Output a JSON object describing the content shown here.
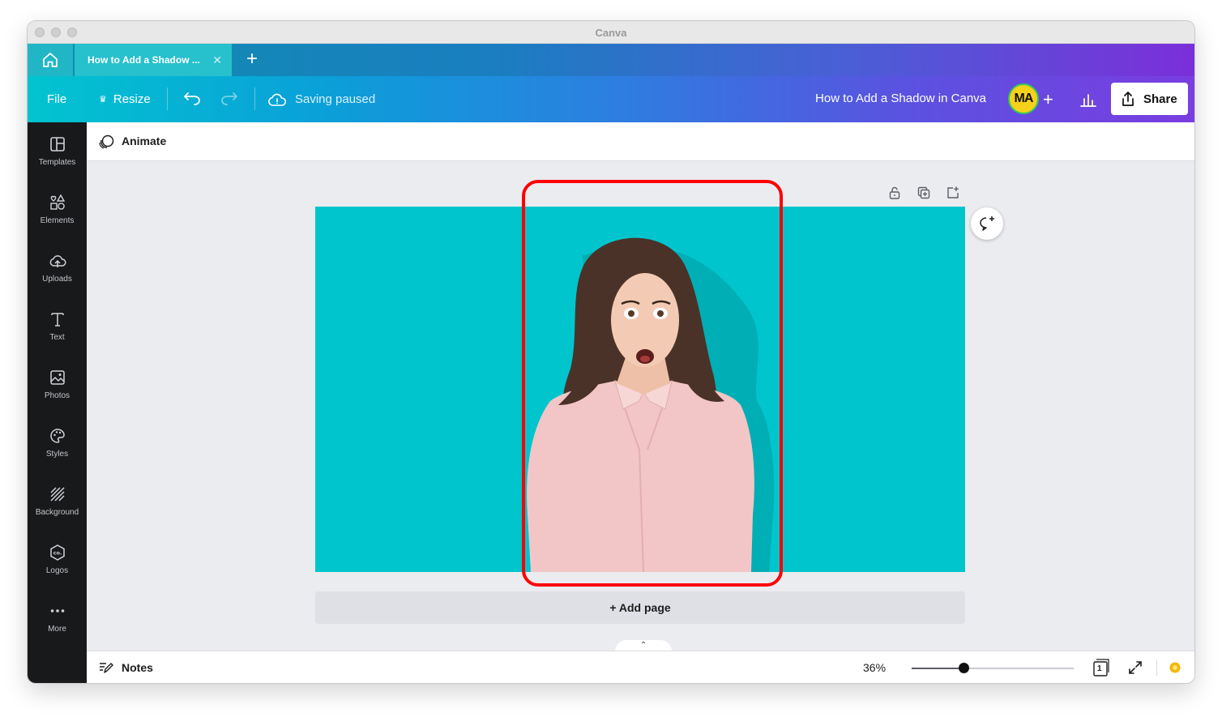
{
  "window": {
    "title": "Canva"
  },
  "tabs": {
    "home_icon": "home-icon",
    "doc_tab_label": "How to Add a Shadow ...",
    "new_tab_symbol": "+"
  },
  "toolbar": {
    "file_label": "File",
    "resize_label": "Resize",
    "saving_status": "Saving paused",
    "doc_title": "How to Add a Shadow in Canva",
    "avatar_initials": "MA",
    "add_collaborator_symbol": "+",
    "share_label": "Share"
  },
  "sidebar": {
    "items": [
      {
        "label": "Templates",
        "icon": "templates-icon"
      },
      {
        "label": "Elements",
        "icon": "elements-icon"
      },
      {
        "label": "Uploads",
        "icon": "uploads-icon"
      },
      {
        "label": "Text",
        "icon": "text-icon"
      },
      {
        "label": "Photos",
        "icon": "photos-icon"
      },
      {
        "label": "Styles",
        "icon": "styles-icon"
      },
      {
        "label": "Background",
        "icon": "background-icon"
      },
      {
        "label": "Logos",
        "icon": "logos-icon"
      },
      {
        "label": "More",
        "icon": "more-icon"
      }
    ]
  },
  "editor": {
    "animate_label": "Animate",
    "add_page_label": "+ Add page",
    "page_background": "#00c5cd",
    "highlight_color": "#ff0000"
  },
  "bottombar": {
    "notes_label": "Notes",
    "zoom_level": "36%",
    "zoom_fraction": 0.32,
    "page_number": "1"
  },
  "colors": {
    "accent_teal": "#00c4cc",
    "accent_purple": "#7d2ae8",
    "sidebar_bg": "#18191b"
  }
}
